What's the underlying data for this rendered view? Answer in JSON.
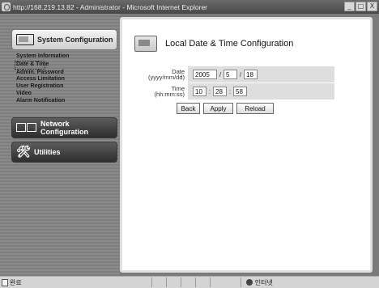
{
  "window": {
    "title": "http://168.219.13.82 - Administrator - Microsoft Internet Explorer",
    "controls": [
      "_",
      "□",
      "X"
    ]
  },
  "sidebar": {
    "sections": [
      {
        "label": "System Configuration",
        "icon": "monitor-icon",
        "active": true
      },
      {
        "label": "Network Configuration",
        "icon": "network-icon",
        "active": false
      },
      {
        "label": "Utilities",
        "icon": "tools-icon",
        "active": false
      }
    ],
    "menu": [
      {
        "label": "System Information"
      },
      {
        "label": "Date & Time",
        "selected": true
      },
      {
        "label": "Admin. Password"
      },
      {
        "label": "Access Limitation"
      },
      {
        "label": "User Registration"
      },
      {
        "label": "Video"
      },
      {
        "label": "Alarm Notification"
      }
    ]
  },
  "page": {
    "title": "Local Date & Time Configuration",
    "date": {
      "label_line1": "Date",
      "label_line2": "(yyyy/mm/dd)",
      "year": "2005",
      "month": "5",
      "day": "18",
      "separator": "/"
    },
    "time": {
      "label_line1": "Time",
      "label_line2": "(hh:mm:ss)",
      "hour": "10",
      "minute": "28",
      "second": "58",
      "separator": ":"
    },
    "buttons": {
      "back": "Back",
      "apply": "Apply",
      "reload": "Reload"
    }
  },
  "status": {
    "left": "완료",
    "zone": "인터넷"
  },
  "colors": {
    "sidebar_bg": "#8a8a8a",
    "content_bg": "#ffffff",
    "field_bg": "#dedede",
    "active_section": "#e8e8e8",
    "inactive_section": "#3a3a3a"
  }
}
